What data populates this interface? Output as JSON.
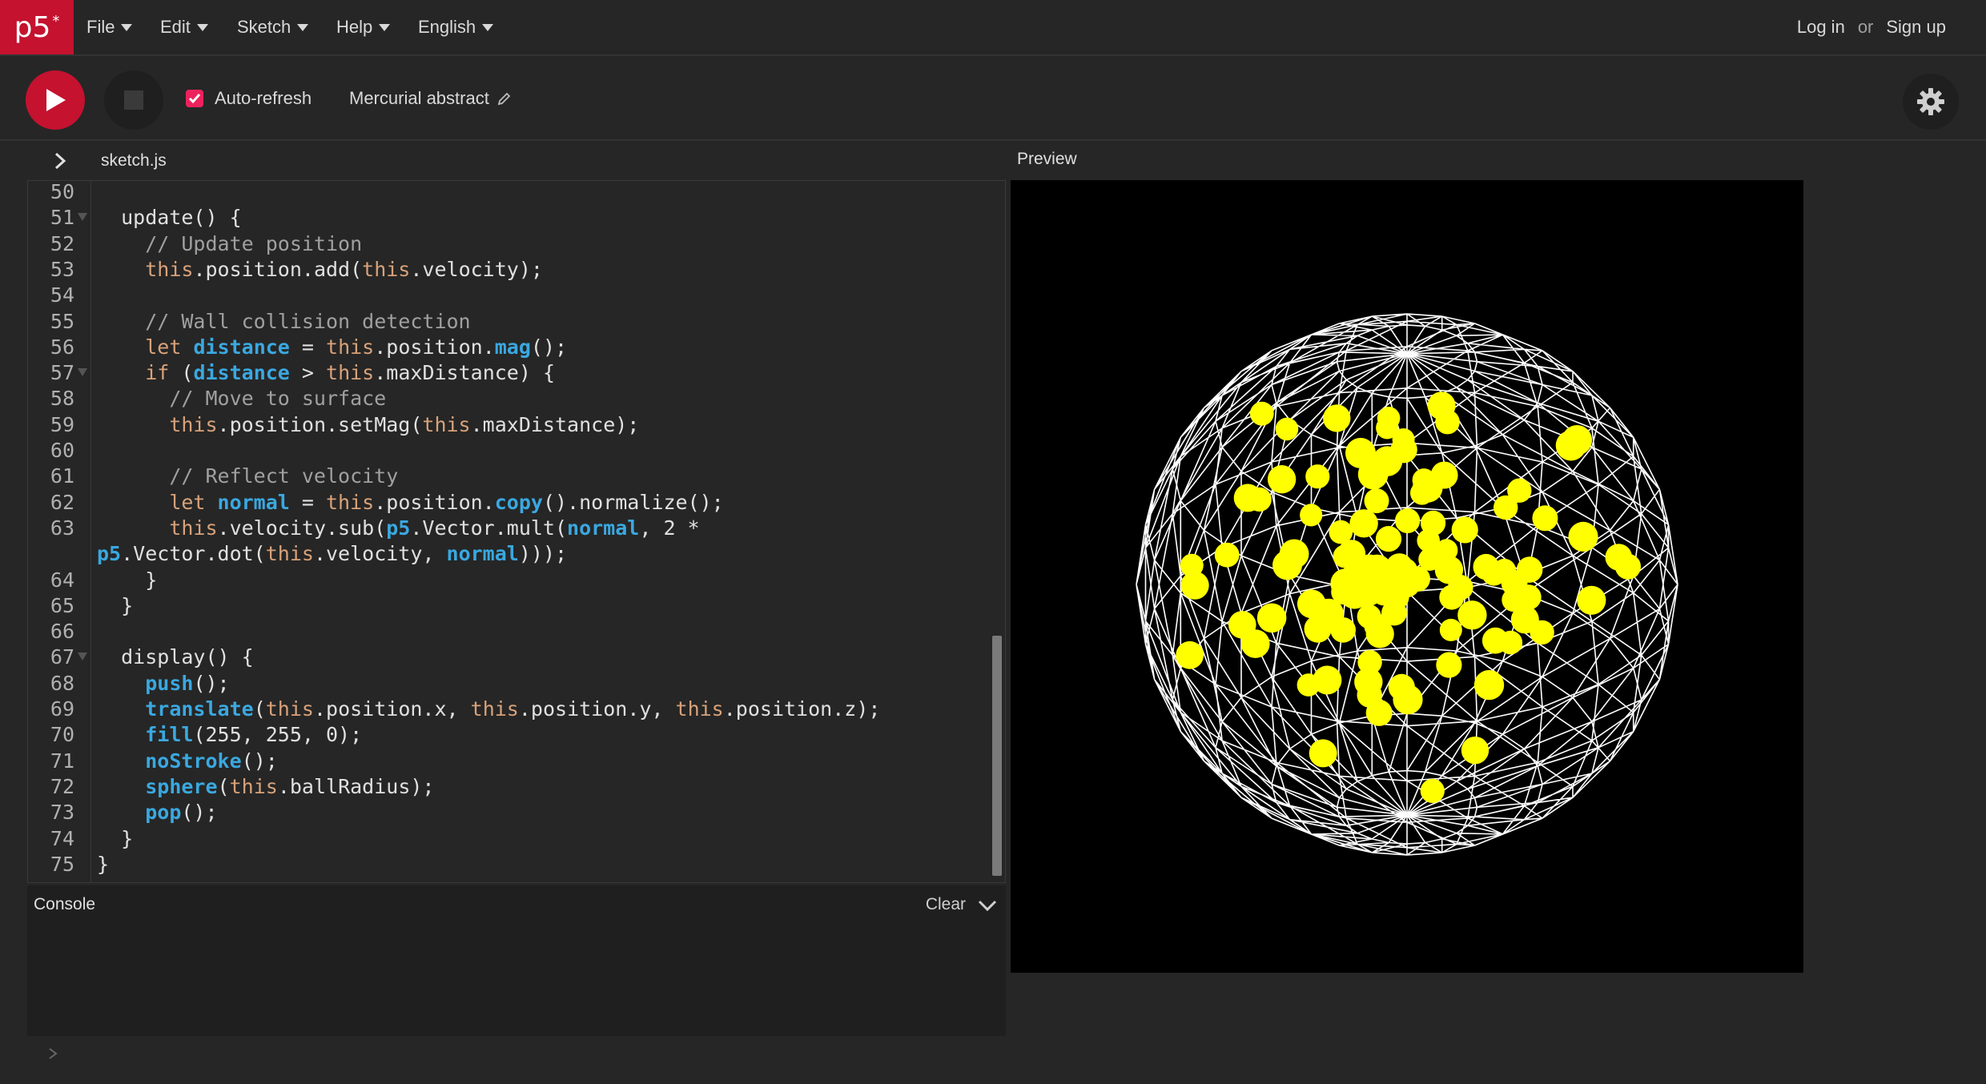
{
  "nav": {
    "logo": "p5",
    "logo_sup": "*",
    "menus": [
      "File",
      "Edit",
      "Sketch",
      "Help",
      "English"
    ],
    "login": "Log in",
    "or": "or",
    "signup": "Sign up"
  },
  "toolbar": {
    "autorefresh_label": "Auto-refresh",
    "autorefresh_checked": true,
    "sketch_name": "Mercurial abstract"
  },
  "editor": {
    "file_name": "sketch.js",
    "lines": [
      {
        "n": "50",
        "text": ""
      },
      {
        "n": "51",
        "text": "  update() {",
        "fold": true
      },
      {
        "n": "52",
        "text": "    // Update position"
      },
      {
        "n": "53",
        "text": "    this.position.add(this.velocity);"
      },
      {
        "n": "54",
        "text": ""
      },
      {
        "n": "55",
        "text": "    // Wall collision detection"
      },
      {
        "n": "56",
        "text": "    let distance = this.position.mag();"
      },
      {
        "n": "57",
        "text": "    if (distance > this.maxDistance) {",
        "fold": true
      },
      {
        "n": "58",
        "text": "      // Move to surface"
      },
      {
        "n": "59",
        "text": "      this.position.setMag(this.maxDistance);"
      },
      {
        "n": "60",
        "text": ""
      },
      {
        "n": "61",
        "text": "      // Reflect velocity"
      },
      {
        "n": "62",
        "text": "      let normal = this.position.copy().normalize();"
      },
      {
        "n": "63",
        "text": "      this.velocity.sub(p5.Vector.mult(normal, 2 *"
      },
      {
        "n": "",
        "text": "p5.Vector.dot(this.velocity, normal)));"
      },
      {
        "n": "64",
        "text": "    }"
      },
      {
        "n": "65",
        "text": "  }"
      },
      {
        "n": "66",
        "text": ""
      },
      {
        "n": "67",
        "text": "  display() {",
        "fold": true
      },
      {
        "n": "68",
        "text": "    push();"
      },
      {
        "n": "69",
        "text": "    translate(this.position.x, this.position.y, this.position.z);"
      },
      {
        "n": "70",
        "text": "    fill(255, 255, 0);"
      },
      {
        "n": "71",
        "text": "    noStroke();"
      },
      {
        "n": "72",
        "text": "    sphere(this.ballRadius);"
      },
      {
        "n": "73",
        "text": "    pop();"
      },
      {
        "n": "74",
        "text": "  }"
      },
      {
        "n": "75",
        "text": "}"
      }
    ]
  },
  "console": {
    "title": "Console",
    "clear_label": "Clear"
  },
  "preview": {
    "label": "Preview",
    "ball_color": "#ffff00",
    "wire_color": "#ffffff"
  },
  "colors": {
    "accent": "#ed225d",
    "background": "#262626"
  }
}
